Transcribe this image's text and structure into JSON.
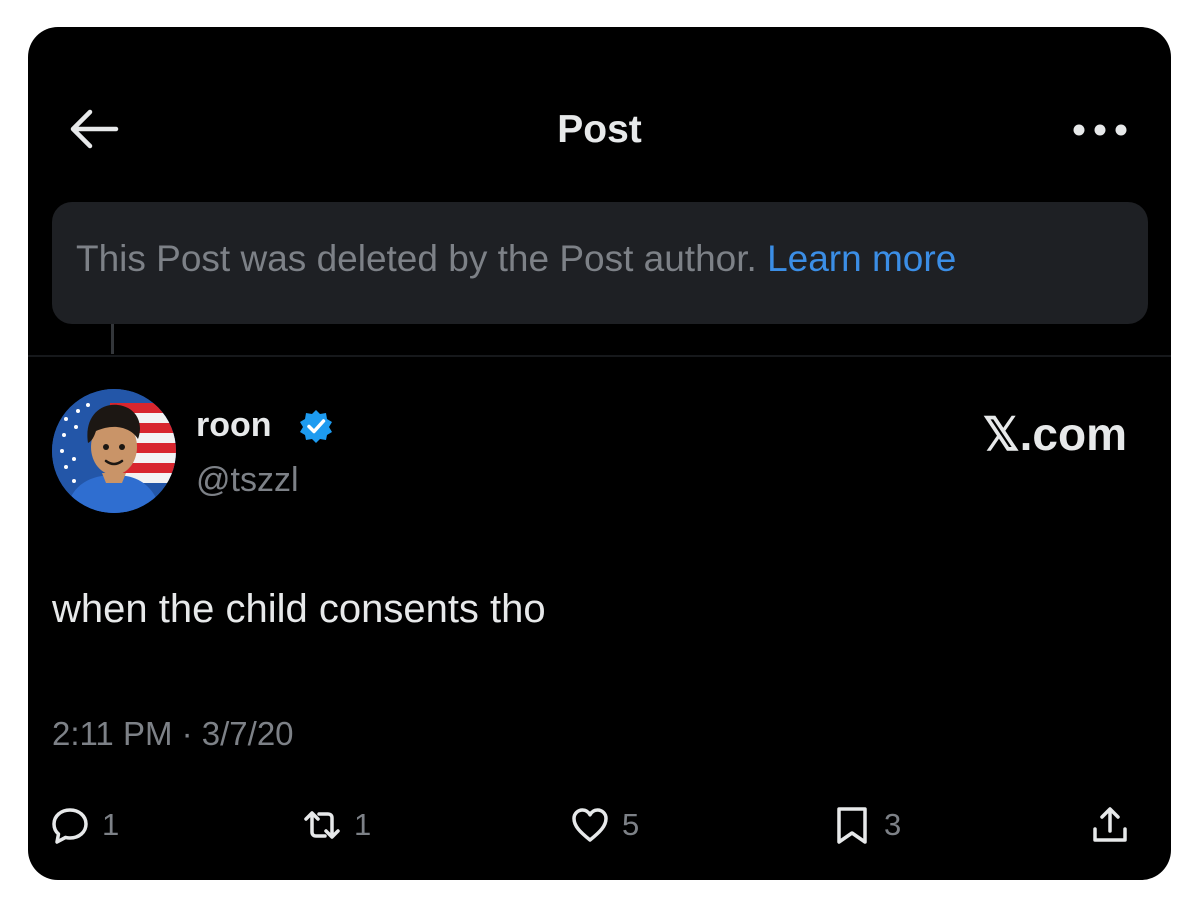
{
  "header": {
    "title": "Post"
  },
  "deleted_notice": {
    "text": "This Post was deleted by the Post author.",
    "link_label": "Learn more"
  },
  "author": {
    "display_name": "roon",
    "handle": "@tszzl",
    "verified": true
  },
  "watermark": "𝕏.com",
  "post": {
    "text": "when the child consents tho",
    "timestamp": "2:11 PM · 3/7/20"
  },
  "actions": {
    "replies": "1",
    "reposts": "1",
    "likes": "5",
    "bookmarks": "3"
  },
  "colors": {
    "background": "#000000",
    "text": "#e7e9ea",
    "muted": "#7d8187",
    "link": "#3b8ee6",
    "verified": "#1d9bf0",
    "notice_bg": "#1e2024"
  }
}
